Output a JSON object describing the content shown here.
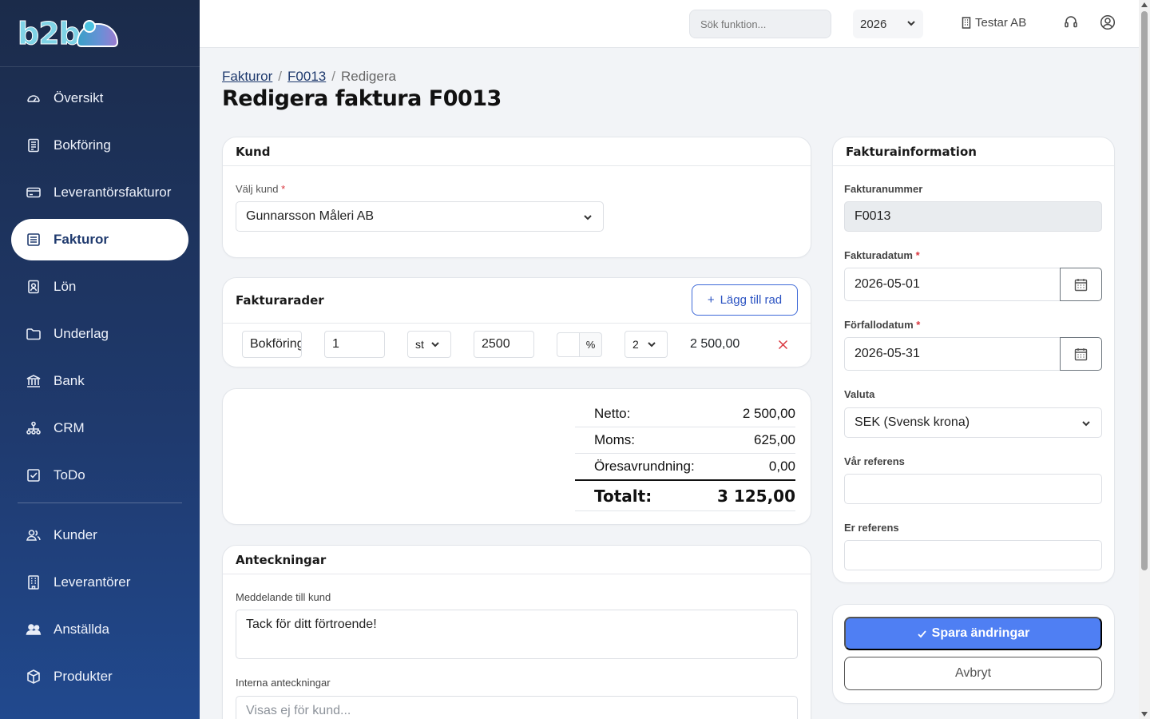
{
  "app": {
    "logo": "b2b"
  },
  "sidebar": {
    "items": [
      {
        "label": "Översikt",
        "icon": "gauge-icon"
      },
      {
        "label": "Bokföring",
        "icon": "ledger-icon"
      },
      {
        "label": "Leverantörsfakturor",
        "icon": "credit-card-icon"
      },
      {
        "label": "Fakturor",
        "icon": "invoice-icon",
        "active": true
      },
      {
        "label": "Lön",
        "icon": "badge-icon"
      },
      {
        "label": "Underlag",
        "icon": "folder-icon"
      },
      {
        "label": "Bank",
        "icon": "bank-icon"
      },
      {
        "label": "CRM",
        "icon": "network-icon"
      },
      {
        "label": "ToDo",
        "icon": "checkbox-icon"
      },
      {
        "label": "Kunder",
        "icon": "people-icon"
      },
      {
        "label": "Leverantörer",
        "icon": "building-icon"
      },
      {
        "label": "Anställda",
        "icon": "team-icon"
      },
      {
        "label": "Produkter",
        "icon": "box-icon"
      }
    ]
  },
  "topbar": {
    "search_placeholder": "Sök funktion...",
    "year": "2026",
    "company": "Testar AB"
  },
  "breadcrumb": {
    "root": "Fakturor",
    "invoice": "F0013",
    "current": "Redigera"
  },
  "page": {
    "title": "Redigera faktura F0013"
  },
  "kund": {
    "title": "Kund",
    "label": "Välj kund",
    "value": "Gunnarsson Måleri AB"
  },
  "rows": {
    "title": "Fakturarader",
    "add_label": "Lägg till rad",
    "line": {
      "description": "Bokföring",
      "quantity": "1",
      "unit": "st",
      "price": "2500",
      "discount": "",
      "percent": "%",
      "vat": "2",
      "amount": "2 500,00"
    }
  },
  "totals": {
    "netto_label": "Netto:",
    "netto": "2 500,00",
    "moms_label": "Moms:",
    "moms": "625,00",
    "ores_label": "Öresavrundning:",
    "ores": "0,00",
    "total_label": "Totalt:",
    "total": "3 125,00"
  },
  "notes": {
    "title": "Anteckningar",
    "message_label": "Meddelande till kund",
    "message": "Tack för ditt förtroende!",
    "internal_label": "Interna anteckningar",
    "internal_placeholder": "Visas ej för kund..."
  },
  "info": {
    "title": "Fakturainformation",
    "number_label": "Fakturanummer",
    "number": "F0013",
    "date_label": "Fakturadatum",
    "date": "2026-05-01",
    "due_label": "Förfallodatum",
    "due": "2026-05-31",
    "currency_label": "Valuta",
    "currency": "SEK (Svensk krona)",
    "our_ref_label": "Vår referens",
    "our_ref": "",
    "your_ref_label": "Er referens",
    "your_ref": ""
  },
  "actions": {
    "save": "Spara ändringar",
    "cancel": "Avbryt"
  },
  "colors": {
    "sidebar": "#1f3a6e",
    "primary": "#4f7ff3",
    "danger": "#d9363e"
  }
}
